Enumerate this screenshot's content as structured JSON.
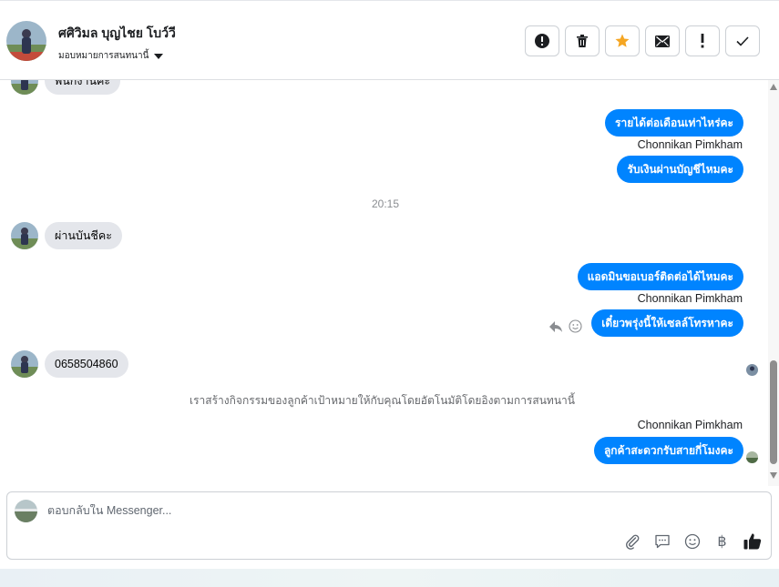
{
  "header": {
    "contact_name": "ศศิวิมล บุญไชย โบว์วี",
    "assign_label": "มอบหมายการสนทนานี้",
    "action_icons": [
      "alert-circle-icon",
      "trash-icon",
      "star-icon",
      "envelope-icon",
      "exclamation-icon",
      "check-icon"
    ],
    "star_color": "#f5a623"
  },
  "messages": {
    "m0_text": "พนักงานคะ",
    "m1_text": "รายได้ต่อเดือนเท่าไหร่คะ",
    "m1_sender": "Chonnikan Pimkham",
    "m2_text": "รับเงินผ่านบัญชีไหมคะ",
    "time_sep": "20:15",
    "m3_text": "ผ่านบันชีคะ",
    "m4_text": "แอดมินขอเบอร์ติดต่อได้ไหมคะ",
    "m4_sender": "Chonnikan Pimkham",
    "m5_text": "เดี๋ยวพรุ่งนี้ให้เซลล์โทรหาคะ",
    "m6_text": "0658504860",
    "system_note": "เราสร้างกิจกรรมของลูกค้าเป้าหมายให้กับคุณโดยอัตโนมัติโดยอิงตามการสนทนานี้",
    "m7_sender": "Chonnikan Pimkham",
    "m7_text": "ลูกค้าสะดวกรับสายกี่โมงคะ"
  },
  "composer": {
    "placeholder": "ตอบกลับใน Messenger...",
    "baht_symbol": "฿",
    "tool_icons": [
      "paperclip-icon",
      "speech-bubble-icon",
      "emoji-icon",
      "baht-icon",
      "thumbs-up-icon"
    ]
  },
  "colors": {
    "outgoing_bubble": "#0084ff",
    "incoming_bubble": "#e4e6eb"
  }
}
